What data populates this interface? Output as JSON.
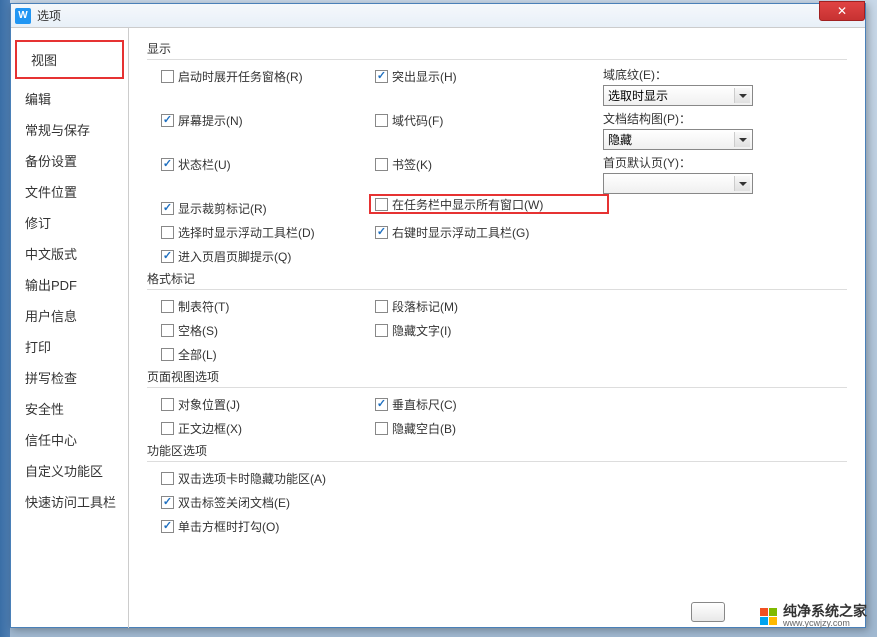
{
  "window": {
    "title": "选项"
  },
  "sidebar": {
    "items": [
      {
        "label": "视图",
        "selected": true
      },
      {
        "label": "编辑"
      },
      {
        "label": "常规与保存"
      },
      {
        "label": "备份设置"
      },
      {
        "label": "文件位置"
      },
      {
        "label": "修订"
      },
      {
        "label": "中文版式"
      },
      {
        "label": "输出PDF"
      },
      {
        "label": "用户信息"
      },
      {
        "label": "打印"
      },
      {
        "label": "拼写检查"
      },
      {
        "label": "安全性"
      },
      {
        "label": "信任中心"
      },
      {
        "label": "自定义功能区"
      },
      {
        "label": "快速访问工具栏"
      }
    ]
  },
  "sections": {
    "display": {
      "title": "显示",
      "col1": [
        {
          "label": "启动时展开任务窗格(R)",
          "checked": false
        },
        {
          "label": "屏幕提示(N)",
          "checked": true
        },
        {
          "label": "状态栏(U)",
          "checked": true
        },
        {
          "label": "显示裁剪标记(R)",
          "checked": true
        },
        {
          "label": "选择时显示浮动工具栏(D)",
          "checked": false
        },
        {
          "label": "进入页眉页脚提示(Q)",
          "checked": true
        }
      ],
      "col2": [
        {
          "label": "突出显示(H)",
          "checked": true
        },
        {
          "label": "域代码(F)",
          "checked": false
        },
        {
          "label": "书签(K)",
          "checked": false
        },
        {
          "label": "在任务栏中显示所有窗口(W)",
          "checked": false,
          "highlight": true
        },
        {
          "label": "右键时显示浮动工具栏(G)",
          "checked": true
        }
      ],
      "col3": [
        {
          "label": "域底纹(E)：",
          "value": "选取时显示"
        },
        {
          "label": "文档结构图(P)：",
          "value": "隐藏"
        },
        {
          "label": "首页默认页(Y)：",
          "value": ""
        }
      ]
    },
    "marks": {
      "title": "格式标记",
      "col1": [
        {
          "label": "制表符(T)",
          "checked": false
        },
        {
          "label": "空格(S)",
          "checked": false
        },
        {
          "label": "全部(L)",
          "checked": false
        }
      ],
      "col2": [
        {
          "label": "段落标记(M)",
          "checked": false
        },
        {
          "label": "隐藏文字(I)",
          "checked": false
        }
      ]
    },
    "pageview": {
      "title": "页面视图选项",
      "col1": [
        {
          "label": "对象位置(J)",
          "checked": false
        },
        {
          "label": "正文边框(X)",
          "checked": false
        }
      ],
      "col2": [
        {
          "label": "垂直标尺(C)",
          "checked": true
        },
        {
          "label": "隐藏空白(B)",
          "checked": false
        }
      ]
    },
    "ribbon": {
      "title": "功能区选项",
      "col1": [
        {
          "label": "双击选项卡时隐藏功能区(A)",
          "checked": false
        },
        {
          "label": "双击标签关闭文档(E)",
          "checked": true
        },
        {
          "label": "单击方框时打勾(O)",
          "checked": true
        }
      ]
    }
  },
  "watermark": {
    "text": "纯净系统之家",
    "url": "www.ycwjzy.com"
  }
}
